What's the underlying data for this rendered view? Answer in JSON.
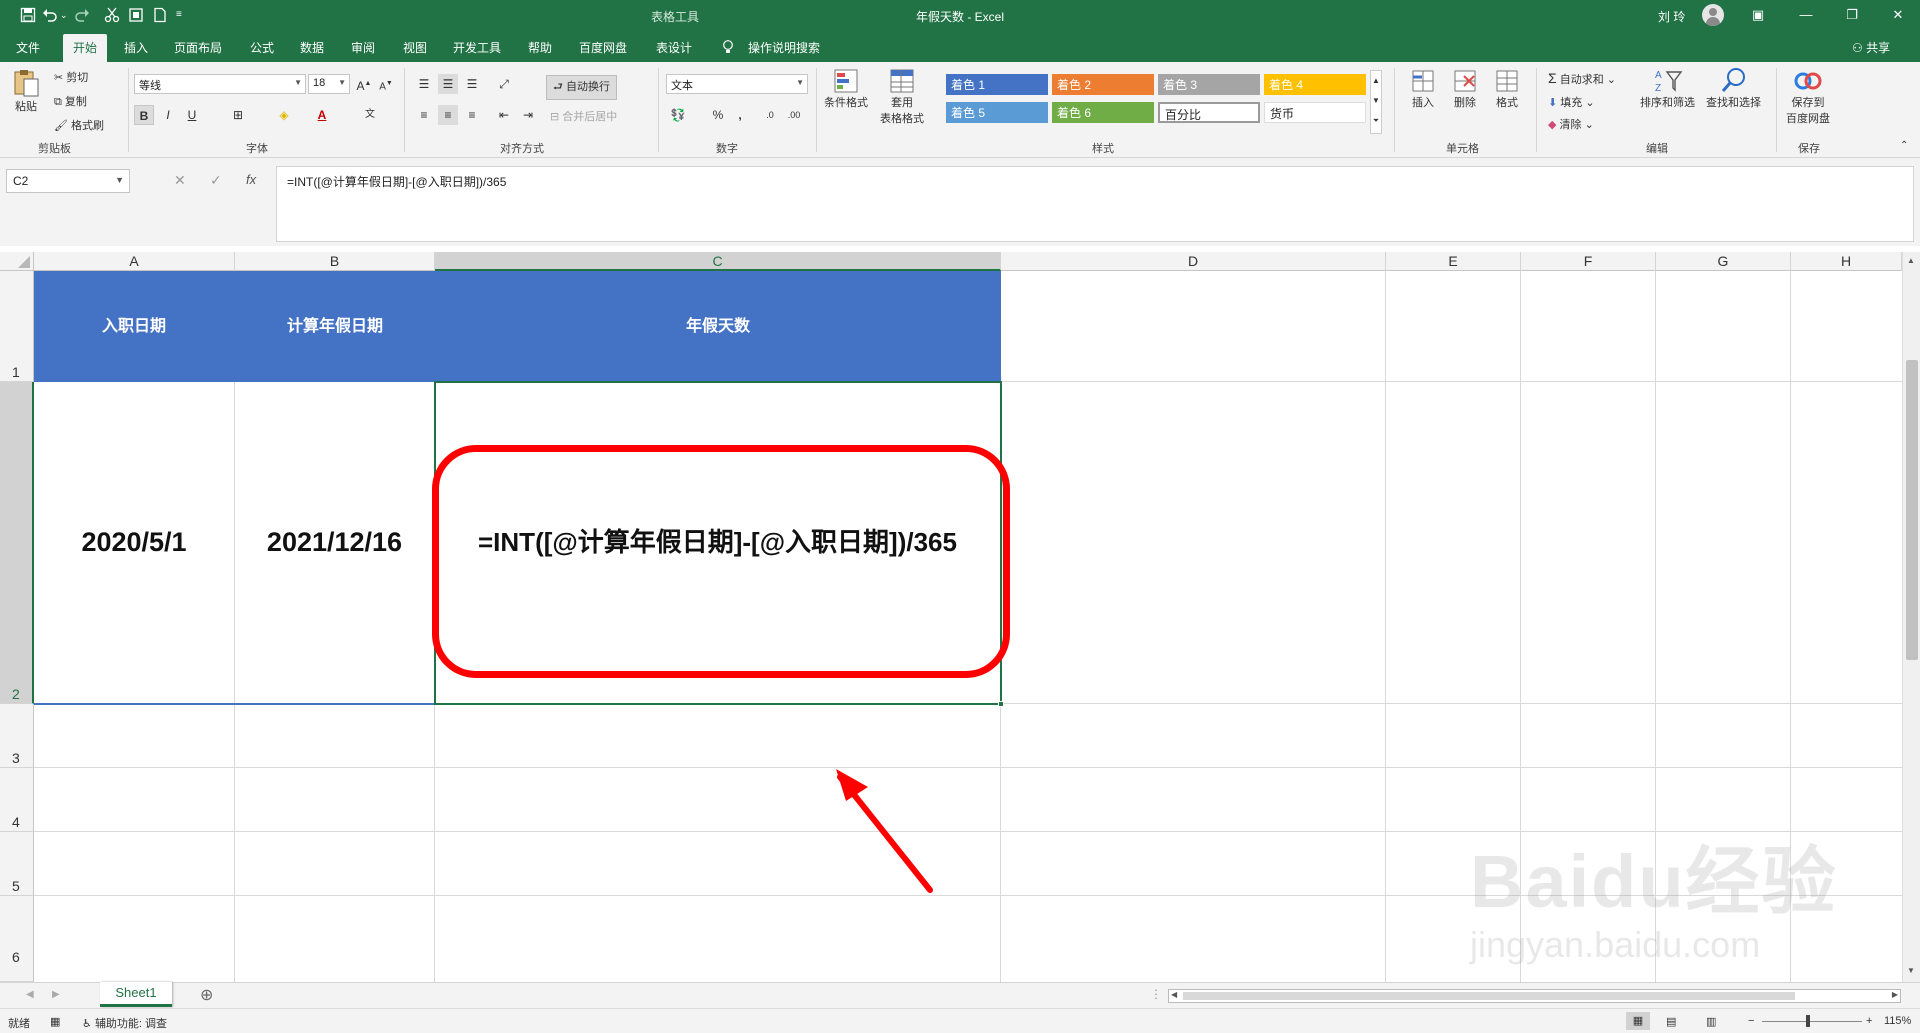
{
  "titlebar": {
    "contextual_group": "表格工具",
    "title": "年假天数  -  Excel",
    "user": "刘 玲",
    "icons": [
      "save-icon",
      "undo-icon",
      "redo-icon",
      "cut-icon",
      "screenshot-icon",
      "new-document-icon",
      "customize-icon",
      "ribbon-display-icon",
      "minimize-icon",
      "restore-icon",
      "close-icon"
    ]
  },
  "tabs": {
    "items": [
      "文件",
      "开始",
      "插入",
      "页面布局",
      "公式",
      "数据",
      "审阅",
      "视图",
      "开发工具",
      "帮助",
      "百度网盘",
      "表设计"
    ],
    "active": "开始",
    "tell_me": "操作说明搜索",
    "share": "共享"
  },
  "ribbon": {
    "clipboard": {
      "paste": "粘贴",
      "cut": "剪切",
      "copy": "复制",
      "format_painter": "格式刷",
      "label": "剪贴板"
    },
    "font": {
      "name": "等线",
      "size": "18",
      "bold": "B",
      "italic": "I",
      "underline": "U",
      "label": "字体"
    },
    "alignment": {
      "wrap_text": "自动换行",
      "merge_center": "合并后居中",
      "label": "对齐方式"
    },
    "number": {
      "format": "文本",
      "percent": "%",
      "comma": ",",
      "label": "数字"
    },
    "styles": {
      "conditional": "条件格式",
      "table_format_1": "套用",
      "table_format_2": "表格格式",
      "cell_styles": [
        {
          "label": "着色 1",
          "color": "#4472c4",
          "text": "#ffffff"
        },
        {
          "label": "着色 2",
          "color": "#ed7d31",
          "text": "#ffffff"
        },
        {
          "label": "着色 3",
          "color": "#a5a5a5",
          "text": "#ffffff"
        },
        {
          "label": "着色 4",
          "color": "#ffc000",
          "text": "#ffffff"
        },
        {
          "label": "着色 5",
          "color": "#5b9bd5",
          "text": "#ffffff"
        },
        {
          "label": "着色 6",
          "color": "#70ad47",
          "text": "#ffffff"
        },
        {
          "label": "百分比",
          "color": "#ffffff",
          "text": "#222222"
        },
        {
          "label": "货币",
          "color": "#ffffff",
          "text": "#222222"
        }
      ],
      "label": "样式"
    },
    "cells": {
      "insert": "插入",
      "delete": "删除",
      "format": "格式",
      "label": "单元格"
    },
    "editing": {
      "autosum": "自动求和",
      "fill": "填充",
      "clear": "清除",
      "sort_filter": "排序和筛选",
      "find_select": "查找和选择",
      "label": "编辑"
    },
    "save": {
      "line1": "保存到",
      "line2": "百度网盘",
      "label": "保存"
    }
  },
  "formula_bar": {
    "name_box": "C2",
    "cancel": "✕",
    "enter": "✓",
    "fx": "fx",
    "formula": "=INT([@计算年假日期]-[@入职日期])/365"
  },
  "grid": {
    "columns": [
      "A",
      "B",
      "C",
      "D",
      "E",
      "F",
      "G",
      "H"
    ],
    "rows": [
      "1",
      "2",
      "3",
      "4",
      "5",
      "6"
    ],
    "selected_column": "C",
    "selected_row": "2",
    "header_row": [
      "入职日期",
      "计算年假日期",
      "年假天数"
    ],
    "data_row": [
      "2020/5/1",
      "2021/12/16",
      "=INT([@计算年假日期]-[@入职日期])/365"
    ],
    "header_color": "#4472c4",
    "highlight_color": "#ff0000"
  },
  "sheets": {
    "tabs": [
      "Sheet1"
    ],
    "add": "⊕"
  },
  "status": {
    "ready": "就绪",
    "accessibility": "辅助功能: 调查",
    "zoom": "115%"
  },
  "watermark": {
    "line1": "Baidu经验",
    "line2": "jingyan.baidu.com"
  }
}
